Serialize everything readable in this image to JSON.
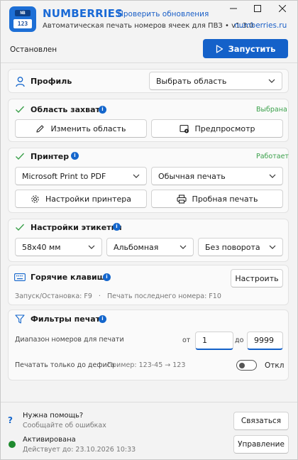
{
  "header": {
    "logo_top": "NB",
    "logo_label": "123",
    "app_name": "NUMBERRIES",
    "update_link": "Проверить обновления",
    "subtitle": "Автоматическая печать номеров ячеек для ПВЗ",
    "version": "• v1.3.0",
    "site_link": "numberries.ru",
    "window_controls": [
      "minimize-icon",
      "maximize-icon",
      "close-icon"
    ]
  },
  "toolbar": {
    "status": "Остановлен",
    "start_label": "Запустить"
  },
  "profile": {
    "title": "Профиль",
    "select_value": "Выбрать область"
  },
  "capture": {
    "title": "Область захвата",
    "status": "Выбрана",
    "edit_label": "Изменить область",
    "preview_label": "Предпросмотр"
  },
  "printer": {
    "title": "Принтер",
    "status": "Работает",
    "printer_value": "Microsoft Print to PDF",
    "mode_value": "Обычная печать",
    "settings_label": "Настройки принтера",
    "test_label": "Пробная печать"
  },
  "label": {
    "title": "Настройки этикетки",
    "size_value": "58x40 мм",
    "orientation_value": "Альбомная",
    "rotation_value": "Без поворота"
  },
  "hotkeys": {
    "title": "Горячие клавиши",
    "configure_label": "Настроить",
    "line": "Запуск/Остановка: F9   ·   Печать последнего номера: F10"
  },
  "filters": {
    "title": "Фильтры печати",
    "range_label": "Диапазон номеров для печати",
    "from_label": "от",
    "from_value": "1",
    "to_label": "до",
    "to_value": "9999",
    "dash_label": "Печатать только до дефиса",
    "dash_example": "Пример: 123-45 → 123",
    "toggle_state": "Откл"
  },
  "footer": {
    "help_title": "Нужна помощь?",
    "help_sub": "Сообщайте об ошибках",
    "contact_label": "Связаться",
    "license_title": "Активирована",
    "license_sub": "Действует до: 23.10.2026 10:33",
    "manage_label": "Управление"
  },
  "colors": {
    "accent": "#1461c9",
    "brand": "#1a6ad6",
    "ok_green": "#3aa04a",
    "active_green": "#1e8a2e"
  }
}
